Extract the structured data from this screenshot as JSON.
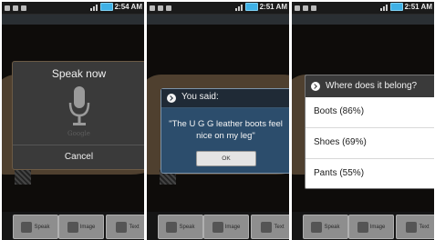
{
  "status_bar": {
    "panel1_time": "2:54 AM",
    "panel2_time": "2:51 AM",
    "panel3_time": "2:51 AM"
  },
  "bottom_buttons": {
    "speak": "Speak",
    "image": "Image",
    "text": "Text"
  },
  "speak_dialog": {
    "title": "Speak now",
    "brand": "Google",
    "cancel": "Cancel"
  },
  "said_dialog": {
    "title": "You said:",
    "text": "\"The U G G leather boots feel nice on my leg\"",
    "ok": "OK"
  },
  "belong_dialog": {
    "title": "Where does it belong?",
    "options": [
      "Boots (86%)",
      "Shoes (69%)",
      "Pants (55%)"
    ]
  },
  "colors": {
    "dialog_blue": "#2c4d6c",
    "battery": "#3fb1e6"
  }
}
